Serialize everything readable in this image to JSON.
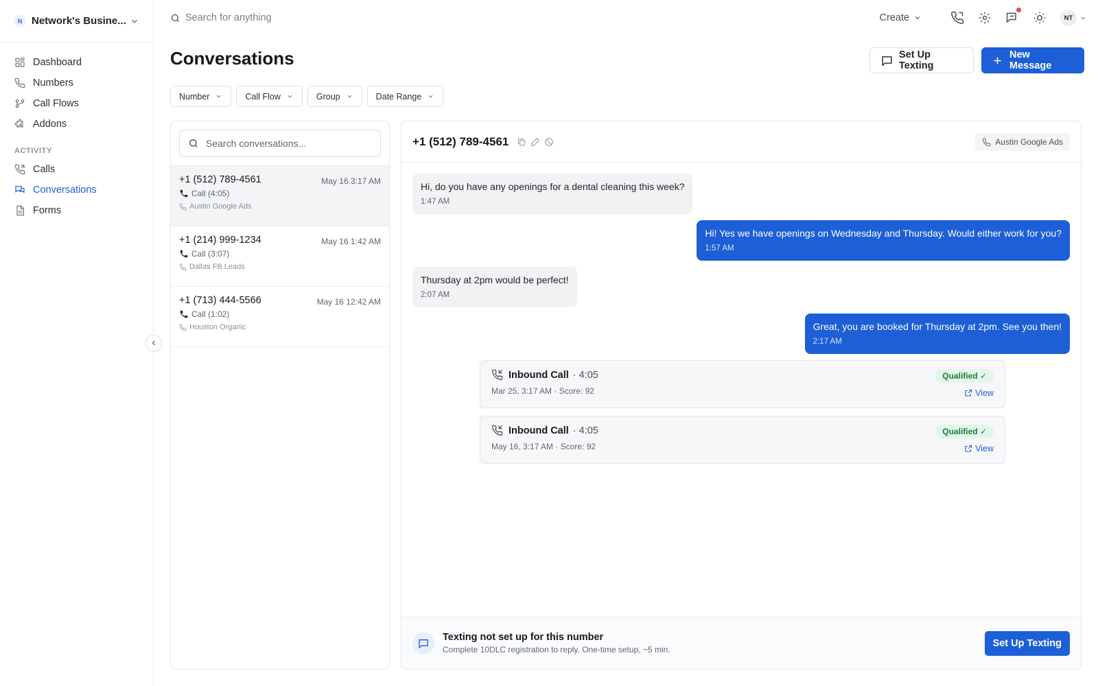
{
  "workspace": {
    "badge": "N",
    "name": "Network's Busine..."
  },
  "sidebar": {
    "items": [
      {
        "label": "Dashboard"
      },
      {
        "label": "Numbers"
      },
      {
        "label": "Call Flows"
      },
      {
        "label": "Addons"
      }
    ],
    "activity_title": "ACTIVITY",
    "activity_items": [
      {
        "label": "Calls"
      },
      {
        "label": "Conversations",
        "active": true
      },
      {
        "label": "Forms"
      }
    ]
  },
  "topbar": {
    "search_placeholder": "Search for anything",
    "create_label": "Create",
    "avatar_initials": "NT"
  },
  "page": {
    "title": "Conversations",
    "setup_texting_label": "Set Up Texting",
    "new_message_label": "New Message"
  },
  "filters": [
    "Number",
    "Call Flow",
    "Group",
    "Date Range"
  ],
  "conversation_list": {
    "search_placeholder": "Search conversations...",
    "items": [
      {
        "phone": "+1 (512) 789-4561",
        "date": "May 16 3:17 AM",
        "call": "Call (4:05)",
        "source": "Austin Google Ads",
        "selected": true
      },
      {
        "phone": "+1 (214) 999-1234",
        "date": "May 16 1:42 AM",
        "call": "Call (3:07)",
        "source": "Dallas FB Leads"
      },
      {
        "phone": "+1 (713) 444-5566",
        "date": "May 16 12:42 AM",
        "call": "Call (1:02)",
        "source": "Houston Organic"
      }
    ]
  },
  "thread": {
    "phone": "+1 (512) 789-4561",
    "source": "Austin Google Ads",
    "messages": [
      {
        "direction": "in",
        "text": "Hi, do you have any openings for a dental cleaning this week?",
        "time": "1:47 AM"
      },
      {
        "direction": "out",
        "text": "Hi! Yes we have openings on Wednesday and Thursday. Would either work for you?",
        "time": "1:57 AM"
      },
      {
        "direction": "in",
        "text": "Thursday at 2pm would be perfect!",
        "time": "2:07 AM"
      },
      {
        "direction": "out",
        "text": "Great, you are booked for Thursday at 2pm. See you then!",
        "time": "2:17 AM"
      }
    ],
    "calls": [
      {
        "title": "Inbound Call",
        "duration": "· 4:05",
        "meta": "Mar 25, 3:17 AM · Score: 92",
        "badge": "Qualified ✓",
        "link": "View"
      },
      {
        "title": "Inbound Call",
        "duration": "· 4:05",
        "meta": "May 16, 3:17 AM · Score: 92",
        "badge": "Qualified ✓",
        "link": "View"
      }
    ],
    "footer": {
      "title": "Texting not set up for this number",
      "subtitle": "Complete 10DLC registration to reply. One-time setup, ~5 min.",
      "button": "Set Up Texting"
    }
  },
  "colors": {
    "accent": "#1d5fd6",
    "qualified_bg": "#e3f5e9",
    "qualified_text": "#1e7a3e",
    "notification_dot": "#e5484d"
  },
  "icons": {
    "nav": [
      "dashboard-icon",
      "phone-icon",
      "call-flow-icon",
      "puzzle-icon",
      "calls-icon",
      "chat-icon",
      "forms-icon"
    ],
    "top": [
      "phone-icon",
      "gear-icon",
      "chat-icon",
      "sun-icon"
    ]
  }
}
